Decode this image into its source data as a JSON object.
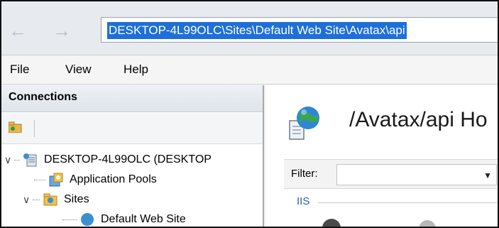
{
  "address_bar": {
    "path": "DESKTOP-4L99OLC\\Sites\\Default Web Site\\Avatax\\api"
  },
  "menu": [
    "File",
    "View",
    "Help"
  ],
  "connections": {
    "title": "Connections",
    "tree": {
      "server": "DESKTOP-4L99OLC (DESKTOP",
      "app_pools": "Application Pools",
      "sites": "Sites",
      "default_site": "Default Web Site"
    }
  },
  "content": {
    "title": "/Avatax/api Ho",
    "filter_label": "Filter:",
    "group_label": "IIS"
  },
  "colors": {
    "selection": "#1e6fd9",
    "group_label": "#2f5ea8"
  }
}
